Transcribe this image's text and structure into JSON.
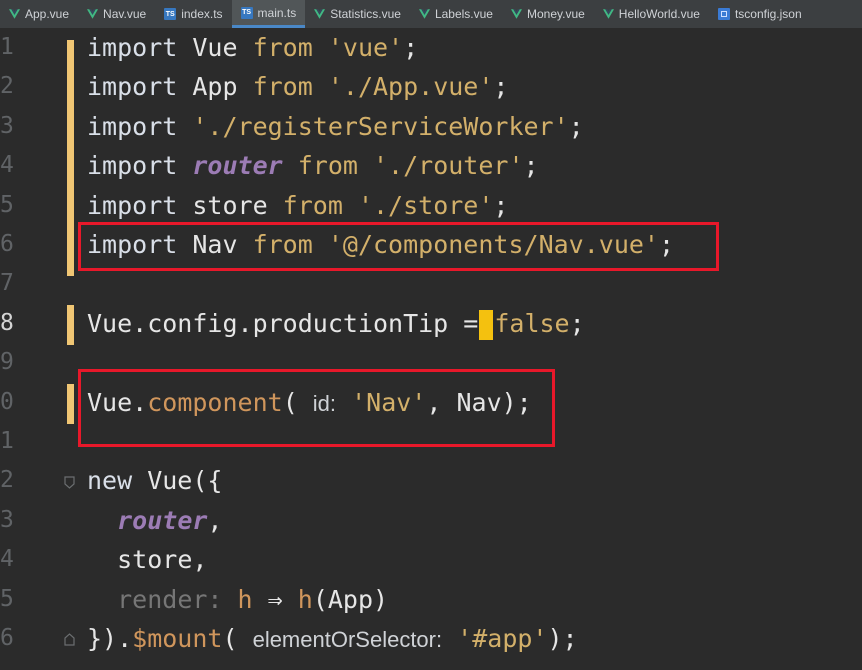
{
  "tabs": [
    {
      "label": "App.vue",
      "icon": "vue-icon"
    },
    {
      "label": "Nav.vue",
      "icon": "vue-icon"
    },
    {
      "label": "index.ts",
      "icon": "ts-icon"
    },
    {
      "label": "main.ts",
      "icon": "ts-icon",
      "active": true
    },
    {
      "label": "Statistics.vue",
      "icon": "vue-icon"
    },
    {
      "label": "Labels.vue",
      "icon": "vue-icon"
    },
    {
      "label": "Money.vue",
      "icon": "vue-icon"
    },
    {
      "label": "HelloWorld.vue",
      "icon": "vue-icon"
    },
    {
      "label": "tsconfig.json",
      "icon": "json-icon"
    }
  ],
  "line_numbers": [
    "1",
    "2",
    "3",
    "4",
    "5",
    "6",
    "7",
    "8",
    "9",
    "0",
    "1",
    "2",
    "3",
    "4",
    "5",
    "6"
  ],
  "current_line_index": 7,
  "code": {
    "l1": {
      "kw": "import",
      "name": " Vue ",
      "from": "from",
      "str": " 'vue'",
      "end": ";"
    },
    "l2": {
      "kw": "import",
      "name": " App ",
      "from": "from",
      "str": " './App.vue'",
      "end": ";"
    },
    "l3": {
      "kw": "import",
      "str": " './registerServiceWorker'",
      "end": ";"
    },
    "l4": {
      "kw": "import",
      "router": "router",
      "from": " from",
      "str": " './router'",
      "end": ";"
    },
    "l5": {
      "kw": "import",
      "name": " store ",
      "from": "from",
      "str": " './store'",
      "end": ";"
    },
    "l6": {
      "kw": "import",
      "name": " Nav ",
      "from": "from",
      "str": " '@/components/Nav.vue'",
      "end": ";"
    },
    "l8": {
      "pre": "Vue.config.productionTip =",
      "post": "false",
      "end": ";"
    },
    "l10": {
      "obj": "Vue.",
      "fn": "component",
      "open": "( ",
      "hint": "id:",
      "str": " 'Nav'",
      "rest": ", Nav);"
    },
    "l12": {
      "kw": "new",
      "rest": " Vue({"
    },
    "l13": {
      "router": "router",
      "rest": ","
    },
    "l14": {
      "rest": "store,"
    },
    "l15": {
      "dim": "render: ",
      "h": "h",
      "arrow": " ⇒ ",
      "fn": "h",
      "rest": "(App)"
    },
    "l16": {
      "pre": "}).",
      "fn": "$mount",
      "open": "( ",
      "hint": "elementOrSelector:",
      "str": " '#app'",
      "end": ");"
    }
  },
  "colors": {
    "highlight_box": "#e8182a",
    "cursor": "#f4c10f",
    "vcs_marker": "#f0c674"
  }
}
